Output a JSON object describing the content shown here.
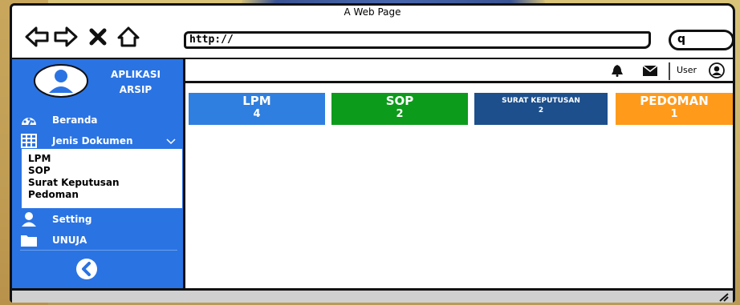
{
  "window": {
    "title": "A Web Page"
  },
  "browser": {
    "url": "http://",
    "icons": [
      "back-arrow-icon",
      "forward-arrow-icon",
      "close-x-icon",
      "home-icon",
      "search-icon"
    ],
    "search_glyph": "q"
  },
  "sidebar": {
    "app_title_line1": "APLIKASI",
    "app_title_line2": "ARSIP",
    "items": [
      {
        "label": "Beranda",
        "icon": "dashboard-gauge-icon"
      },
      {
        "label": "Jenis Dokumen",
        "icon": "table-grid-icon",
        "expanded": true
      },
      {
        "label": "Setting",
        "icon": "user-icon"
      },
      {
        "label": "UNUJA",
        "icon": "folder-icon"
      }
    ],
    "submenu": [
      "LPM",
      "SOP",
      "Surat Keputusan",
      "Pedoman"
    ],
    "collapse_icon": "chevron-left-circle-icon"
  },
  "topbar": {
    "user_label": "User",
    "icons": [
      "bell-icon",
      "mail-icon",
      "user-circle-icon"
    ]
  },
  "cards": [
    {
      "name": "LPM",
      "count": "4",
      "color": "#2f7fe0"
    },
    {
      "name": "SOP",
      "count": "2",
      "color": "#0d9b1b"
    },
    {
      "name": "SURAT KEPUTUSAN",
      "count": "2",
      "color": "#1d4f8c"
    },
    {
      "name": "PEDOMAN",
      "count": "1",
      "color": "#ff9a1a"
    }
  ],
  "colors": {
    "sidebar": "#2a73e3",
    "submenu_bg": "#ffffff",
    "statusbar": "#d0d0d0"
  }
}
